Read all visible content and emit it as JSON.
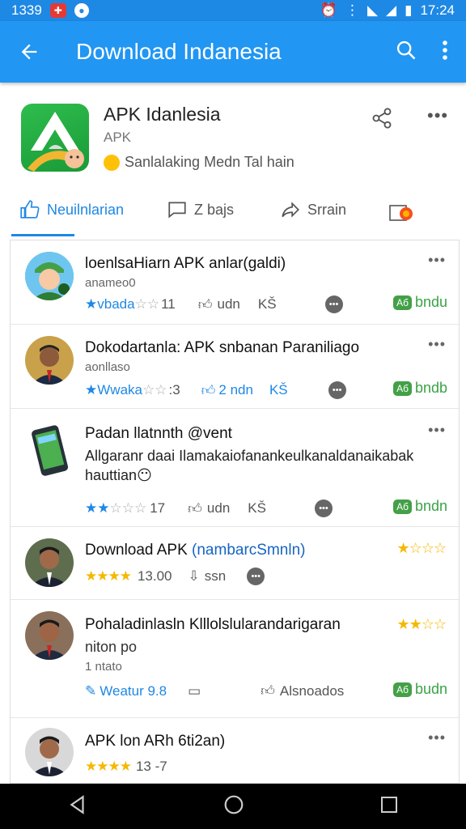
{
  "status": {
    "time_left": "1339",
    "time_right": "17:24"
  },
  "appbar": {
    "title": "Download Indanesia"
  },
  "app": {
    "name": "APK Idanlesia",
    "sub": "APK",
    "tagline": "Sanlalaking Medn Tal hain"
  },
  "tabs": [
    {
      "label": "Neuilnlarian"
    },
    {
      "label": "Z bajs"
    },
    {
      "label": "Srrain"
    }
  ],
  "posts": [
    {
      "title": "loenlsaHiarn APK anlar(galdi)",
      "sub": "anameo0",
      "rating_label": "vbada",
      "rating_num": "11",
      "like_label": "udn",
      "count": "KŠ",
      "dl_pill": "Аб",
      "dl_label": "bndu"
    },
    {
      "title": "Dokodartanla: APK snbanan Paraniliago",
      "sub": "aonllaso",
      "rating_label": "Wwaka",
      "rating_num": ":3",
      "like_label": "2 ndn",
      "count": "KŠ",
      "dl_pill": "Аб",
      "dl_label": "bndb"
    },
    {
      "title": "Padan llatnnth @vent",
      "sub": "Allgaranr daai Ilamakaiofanankeulkanaldanaikabak",
      "sub2": "hauttian",
      "rating_num": "17",
      "like_label": "udn",
      "count": "KŠ",
      "dl_pill": "Аб",
      "dl_label": "bndn"
    },
    {
      "title": "Download APK ",
      "title_accent": "(nambarcSmnln)",
      "rating_num": "13.00",
      "like_label": "ssn"
    },
    {
      "title": "Pohaladinlasln Klllolslularandarigaran",
      "sub": "niton po",
      "sub2": "1 ntato",
      "rating_label": "Weatur 9.8",
      "like_label": "Alsnoados",
      "dl_pill": "Аб",
      "dl_label": "budn"
    },
    {
      "title": "APK lon ARh 6ti2an)",
      "rating_num": "13 -7"
    }
  ]
}
